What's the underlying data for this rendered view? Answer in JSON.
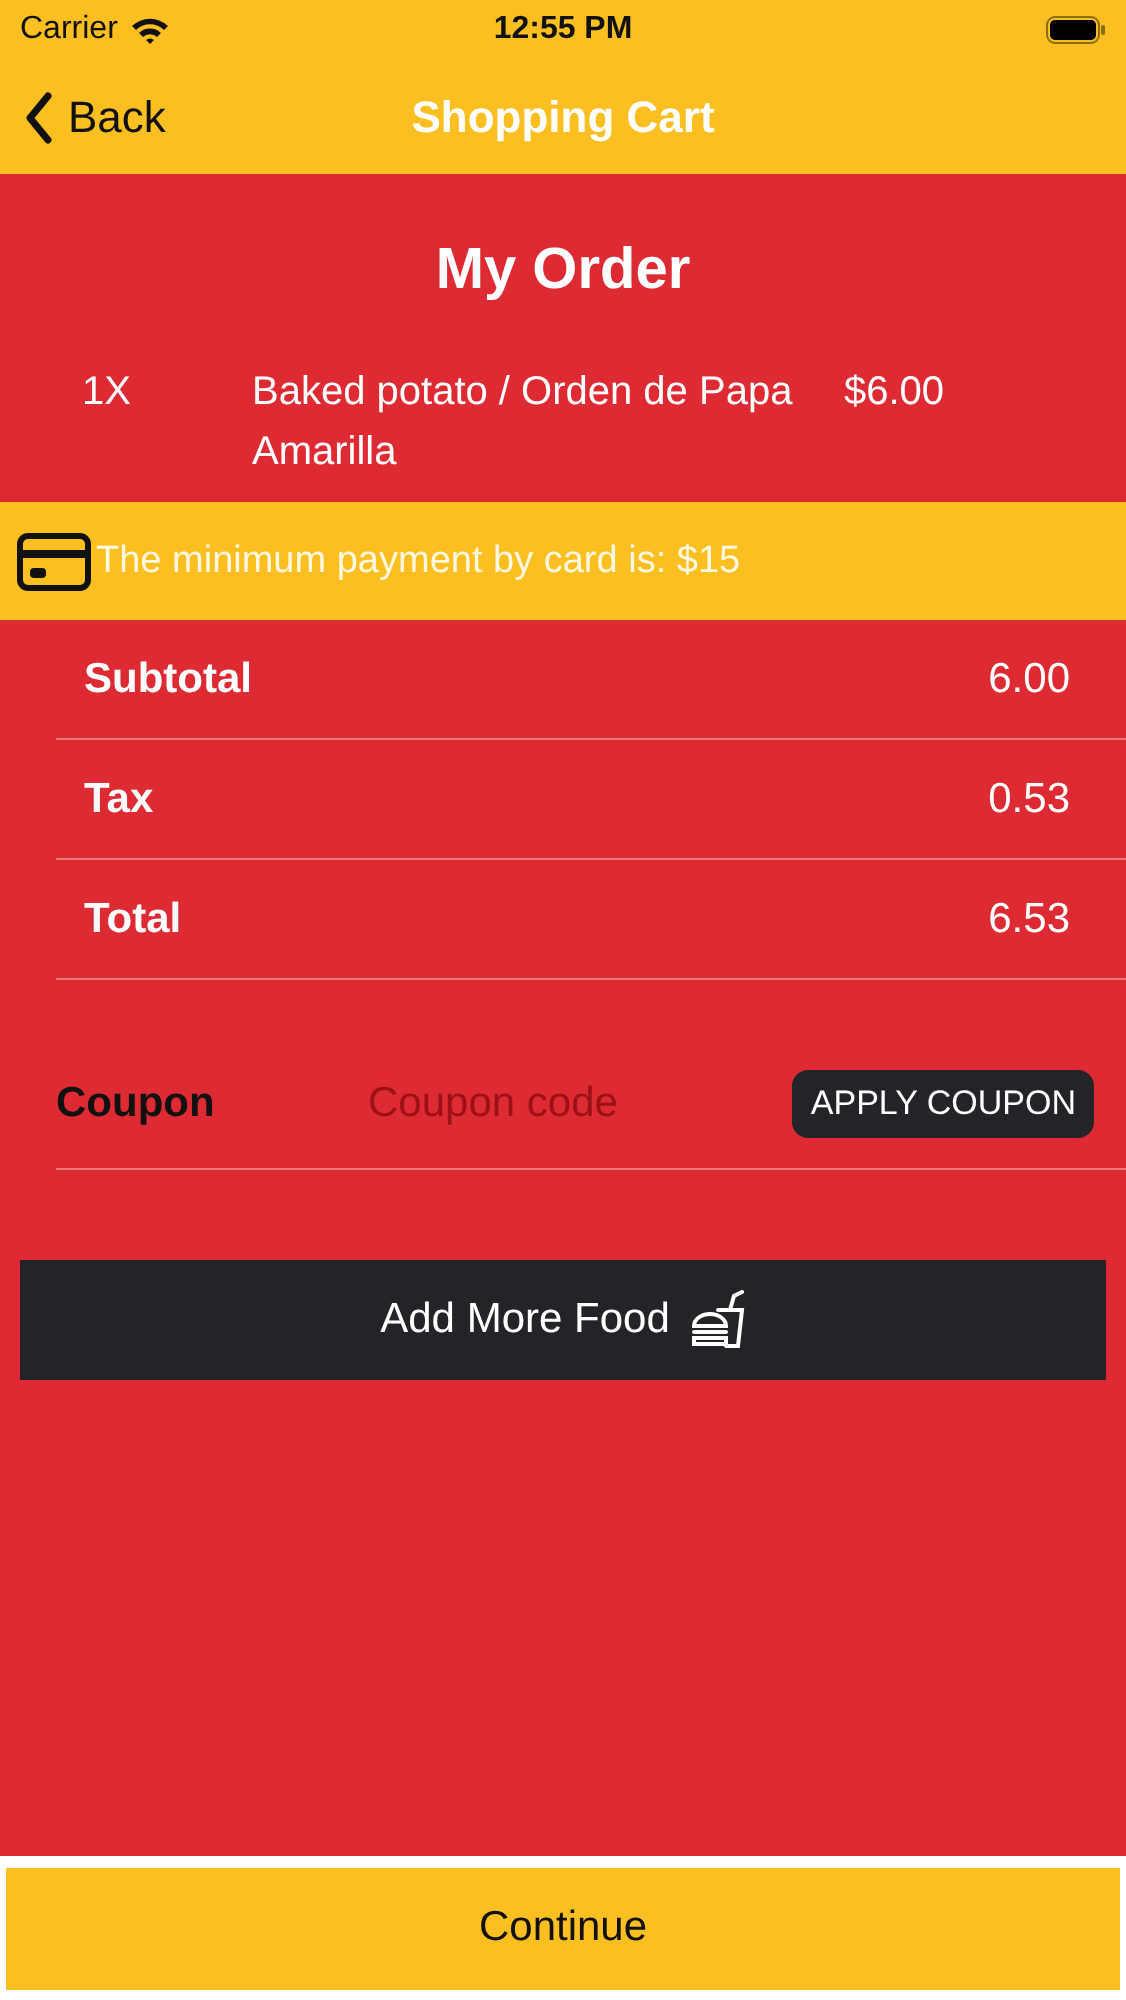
{
  "status_bar": {
    "carrier": "Carrier",
    "time": "12:55 PM"
  },
  "nav": {
    "back": "Back",
    "title": "Shopping Cart"
  },
  "order": {
    "title": "My Order",
    "items": [
      {
        "quantity": "1X",
        "name": "Baked potato / Orden de Papa Amarilla",
        "price": "$6.00"
      }
    ]
  },
  "notice": "The minimum payment by card is: $15",
  "summary": [
    {
      "label": "Subtotal",
      "value": "6.00"
    },
    {
      "label": "Tax",
      "value": "0.53"
    },
    {
      "label": "Total",
      "value": "6.53"
    }
  ],
  "coupon": {
    "label": "Coupon",
    "placeholder": "Coupon code",
    "button": "APPLY COUPON"
  },
  "add_more": "Add More Food",
  "continue": "Continue"
}
